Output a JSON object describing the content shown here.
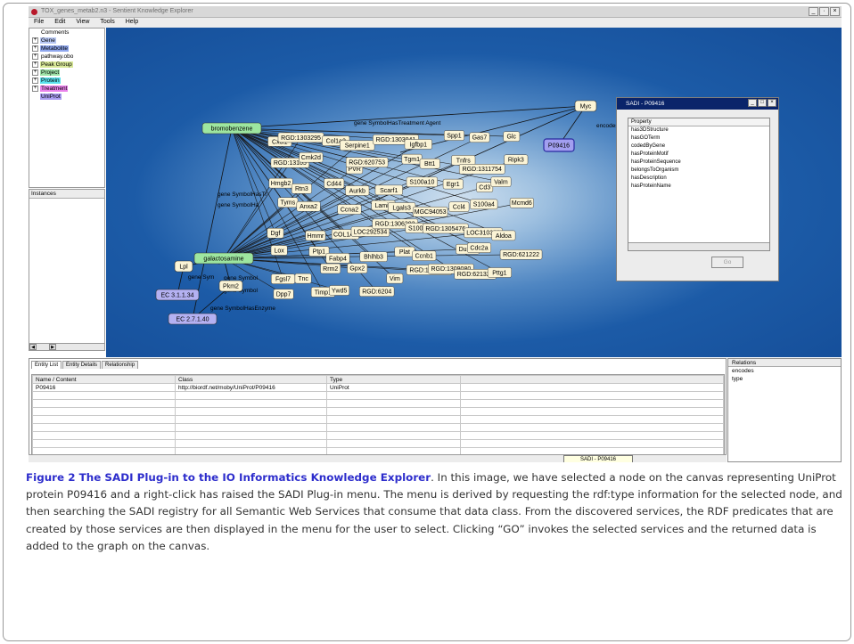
{
  "window": {
    "title": "TOX_genes_metab2.n3 - Sentient Knowledge Explorer",
    "buttons": [
      "_",
      "·",
      "×"
    ]
  },
  "menu": [
    "File",
    "Edit",
    "View",
    "Tools",
    "Help"
  ],
  "tree": [
    {
      "label": "Comments",
      "color": "#ffffff",
      "expand": false
    },
    {
      "label": "Gene",
      "color": "#b8c8f4",
      "expand": true
    },
    {
      "label": "Metabolite",
      "color": "#8fa7ee",
      "expand": true
    },
    {
      "label": "pathway.obo",
      "color": "#ffffff",
      "expand": true
    },
    {
      "label": "Peak Group",
      "color": "#d8e898",
      "expand": true
    },
    {
      "label": "Project",
      "color": "#9ee3a8",
      "expand": true
    },
    {
      "label": "Protein",
      "color": "#5ae0ec",
      "expand": true
    },
    {
      "label": "Treatment",
      "color": "#e982ea",
      "expand": true
    },
    {
      "label": "UniProt",
      "color": "#a99cf0",
      "expand": false
    }
  ],
  "instances_label": "Instances",
  "graph": {
    "nodes": {
      "bromobenzene": "bromobenzene",
      "galactosamine": "galactosamine",
      "myc": "Myc",
      "p09416": "P09416",
      "lpl": "Lpl",
      "pkm2": "Pkm2",
      "ec1": "EC 3.1.1.34",
      "ec2": "EC 2.7.1.40"
    },
    "edges": {
      "treatment": "gene SymbolHasTreatment Agent",
      "encodes": "encodes",
      "enzyme1": "gene SymbolHasEnzyme",
      "enzyme2": "gene SymbolHasEnzyme",
      "sym1": "gene SymbolHasTr",
      "sym2": "gene SymbolHa",
      "sym3": "gene Sy",
      "sym4": "gene Symbol",
      "sym5": "gene Symbol",
      "sym6": "gene Sym"
    },
    "cluster": [
      "Cxcl1",
      "RGD:1303295",
      "Col1a2",
      "Serpine1",
      "RGD:1303041",
      "Igfbp1",
      "Spp1",
      "Gas7",
      "Glc",
      "RGD:13105",
      "Cmk2d",
      "PVR",
      "RGD:620753",
      "Tgm1",
      "Btt1",
      "Tnfrs",
      "RGD:1311754",
      "Ripk3",
      "Hmgb2",
      "Rtn3",
      "Cd44",
      "Aurkb",
      "Scarf1",
      "S100a10",
      "Egr1",
      "Cd3",
      "Valm",
      "Tyms",
      "Anxa2",
      "Ccna2",
      "Lamin",
      "Lgals3",
      "MGC94053",
      "Ccl4",
      "S100a4",
      "Mcmd6",
      "Dgf",
      "Hmmr",
      "COL1A1",
      "LOC292534",
      "RGD:1306203",
      "S100a8",
      "RGD:1305476",
      "LOC310382",
      "Aldoa",
      "Lox",
      "Ptp1",
      "Fabp4",
      "Bhlhb3",
      "Plat",
      "Ccnb1",
      "Dusp5",
      "Cdc2a",
      "RGD:621222",
      "Fgsl7",
      "Tnc",
      "Rrm2",
      "Gpx2",
      "Vim",
      "RGD:1311724",
      "RGD:1309080",
      "RGD:621320",
      "Pttg1",
      "Dpp7",
      "Timp1",
      "Ywd5",
      "RGD:6204"
    ]
  },
  "sadi": {
    "title": "SADI - P09416",
    "header": "Property",
    "properties": [
      "has3DStructure",
      "hasGOTerm",
      "codedByGene",
      "hasProteinMotif",
      "hasProteinSequence",
      "belongsToOrganism",
      "hasDescription",
      "hasProteinName"
    ],
    "go_label": "Go"
  },
  "bottom": {
    "tabs": [
      "Entity List",
      "Entity Details",
      "Relationship"
    ],
    "columns": [
      "Name / Content",
      "Class",
      "Type",
      ""
    ],
    "rows": [
      [
        "P09416",
        "http://biordf.net/moby/UniProt/P09416",
        "UniProt",
        ""
      ]
    ],
    "status_tip": "SADI - P09416"
  },
  "relations": {
    "header": "Relations",
    "items": [
      "encodes",
      "type"
    ]
  },
  "caption": {
    "title": "Figure 2 The SADI Plug-in to the IO Informatics Knowledge Explorer",
    "body": ". In this image, we have selected a node on the canvas representing UniProt protein P09416 and a right-click has raised the SADI Plug-in menu. The menu is derived by requesting the rdf:type information for the selected node, and then searching the SADI registry for all Semantic Web Services that consume that data class. From the discovered services, the RDF predicates that are created by those services are then displayed in the menu for the user to select. Clicking “GO” invokes the selected services and the returned data is added to the graph on the canvas."
  },
  "colors": {
    "agent_node": "#9ee6a0",
    "enzyme_node": "#b4b1f2",
    "gene_node": "#fbf4d6",
    "uniprot_node": "#a29ff0",
    "selected_border": "#2a2aa0",
    "caption_title": "#2d2dcc"
  }
}
